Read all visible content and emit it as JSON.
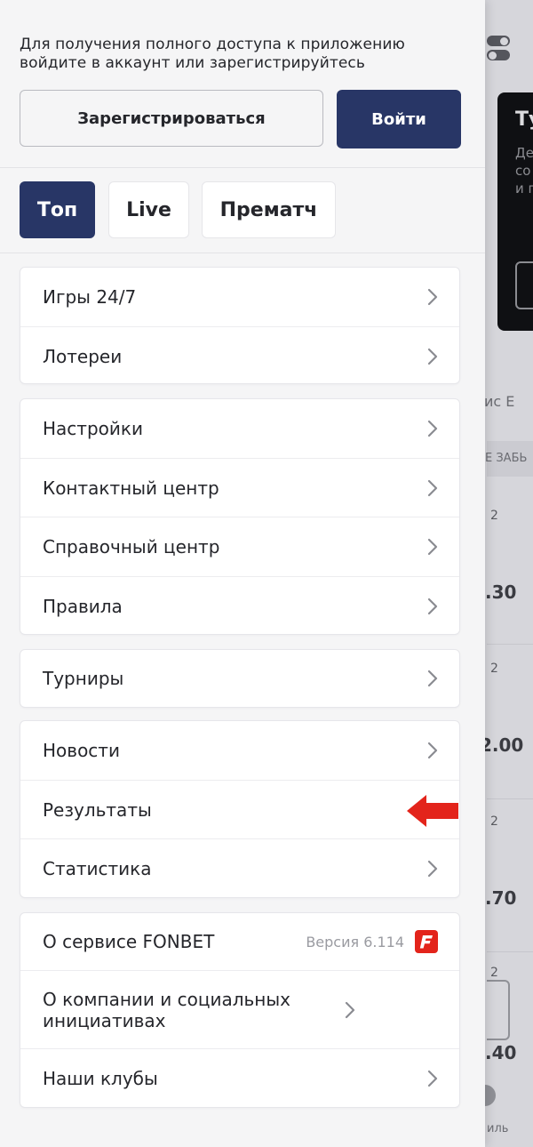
{
  "auth": {
    "notice": "Для получения полного доступа к приложению войдите в аккаунт или зарегистрируйтесь",
    "register_label": "Зарегистрироваться",
    "login_label": "Войти"
  },
  "tabs": [
    {
      "label": "Топ",
      "active": true
    },
    {
      "label": "Live",
      "active": false
    },
    {
      "label": "Прематч",
      "active": false
    }
  ],
  "menu": {
    "group1": [
      "Игры 24/7",
      "Лотереи"
    ],
    "group2": [
      "Настройки",
      "Контактный центр",
      "Справочный центр",
      "Правила"
    ],
    "group3": [
      "Турниры"
    ],
    "group4": [
      "Новости",
      "Результаты",
      "Статистика"
    ],
    "group5": {
      "about_service": "О сервисе FONBET",
      "version": "Версия 6.114",
      "about_company": "О компании и социальных инициативах",
      "clubs": "Наши клубы"
    }
  },
  "background": {
    "banner_title": "Ту",
    "banner_text": "Де\nсо\nи г",
    "tabs_text": "ис   Е",
    "stripe_text": "Е ЗАБЬ",
    "col_label": "2",
    "odds": [
      ".30",
      "2.00",
      ".70",
      ".40"
    ],
    "nav_label": "иль"
  },
  "colors": {
    "primary": "#283666",
    "accent_red": "#e3241b",
    "drawer_bg": "#f5f5f6"
  }
}
